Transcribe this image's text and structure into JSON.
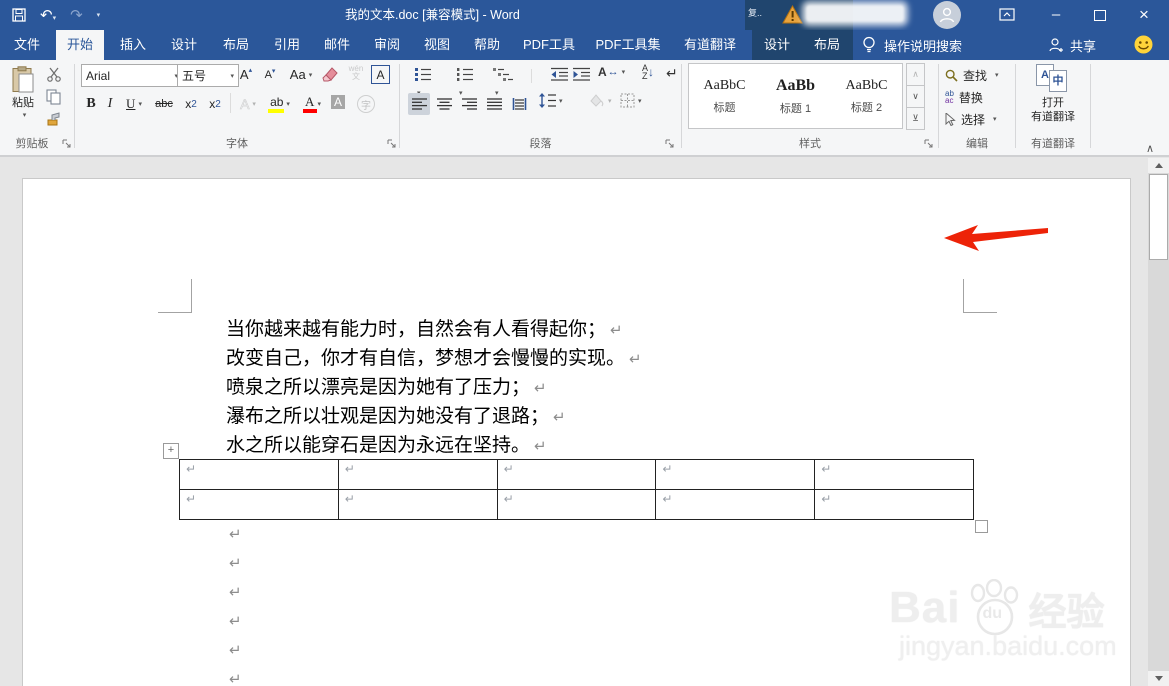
{
  "titlebar": {
    "title": "我的文本.doc [兼容模式]  -  Word",
    "mini_text": "复..",
    "minimize": "–",
    "close": "×"
  },
  "tabs": {
    "items": [
      "文件",
      "开始",
      "插入",
      "设计",
      "布局",
      "引用",
      "邮件",
      "审阅",
      "视图",
      "帮助",
      "PDF工具",
      "PDF工具集",
      "有道翻译"
    ],
    "contextual": [
      "设计",
      "布局"
    ],
    "assistant": "操作说明搜索",
    "share": "共享"
  },
  "ribbon": {
    "clipboard": {
      "label": "剪贴板",
      "paste": "粘贴"
    },
    "font": {
      "label": "字体",
      "name": "Arial",
      "size": "五号",
      "grow": "A",
      "shrink": "A",
      "case": "Aa",
      "bold": "B",
      "italic": "I",
      "underline": "U",
      "strike": "abc",
      "sub_x": "x",
      "sub_digit": "2",
      "sup_x": "x",
      "sup_digit": "2",
      "effects": "A",
      "highlight": "ab",
      "color": "A",
      "char_shading": "A",
      "enclose": "字",
      "char_border": "A",
      "phonetic_top": "wén",
      "phonetic_bottom": "文"
    },
    "paragraph": {
      "label": "段落",
      "asian_a": "A",
      "asian_arrows": "↔",
      "sort_a": "A",
      "sort_z": "Z",
      "sort_arrow": "↓"
    },
    "styles": {
      "label": "样式",
      "items": [
        {
          "sample": "AaBbC",
          "name": "标题"
        },
        {
          "sample": "AaBb",
          "name": "标题 1"
        },
        {
          "sample": "AaBbC",
          "name": "标题 2"
        }
      ],
      "up": "∧",
      "down": "∨",
      "more": "⊻"
    },
    "editing": {
      "label": "编辑",
      "find": "查找",
      "replace": "替换",
      "select": "选择",
      "icon_ab": "ab",
      "icon_ac": "ac"
    },
    "youdao": {
      "label": "有道翻译",
      "button_line1": "打开",
      "button_line2": "有道翻译",
      "icon_a": "A",
      "icon_zh": "中"
    }
  },
  "document": {
    "lines": [
      "当你越来越有能力时，自然会有人看得起你；",
      "改变自己，你才有自信，梦想才会慢慢的实现。",
      "喷泉之所以漂亮是因为她有了压力；",
      "瀑布之所以壮观是因为她没有了退路；",
      "水之所以能穿石是因为永远在坚持。"
    ],
    "pilcrow": "↵",
    "table": {
      "rows": 2,
      "cols": 5
    },
    "move_handle": "+"
  },
  "watermark": {
    "prefix": "Bai",
    "paw_text": "du",
    "suffix": "经验",
    "url": "jingyan.baidu.com"
  },
  "colors": {
    "titlebar_blue": "#2b579a",
    "contextual_blue": "#20456e",
    "ribbon_bg": "#f5f6f7",
    "doc_bg": "#e6e6e6",
    "page_bg": "#ffffff",
    "arrow_red": "#ed2308",
    "highlight_yellow": "#ffff00",
    "font_color_red": "#ff0000",
    "warning_orange": "#e8a33d",
    "smiley_yellow": "#ffd43a"
  }
}
